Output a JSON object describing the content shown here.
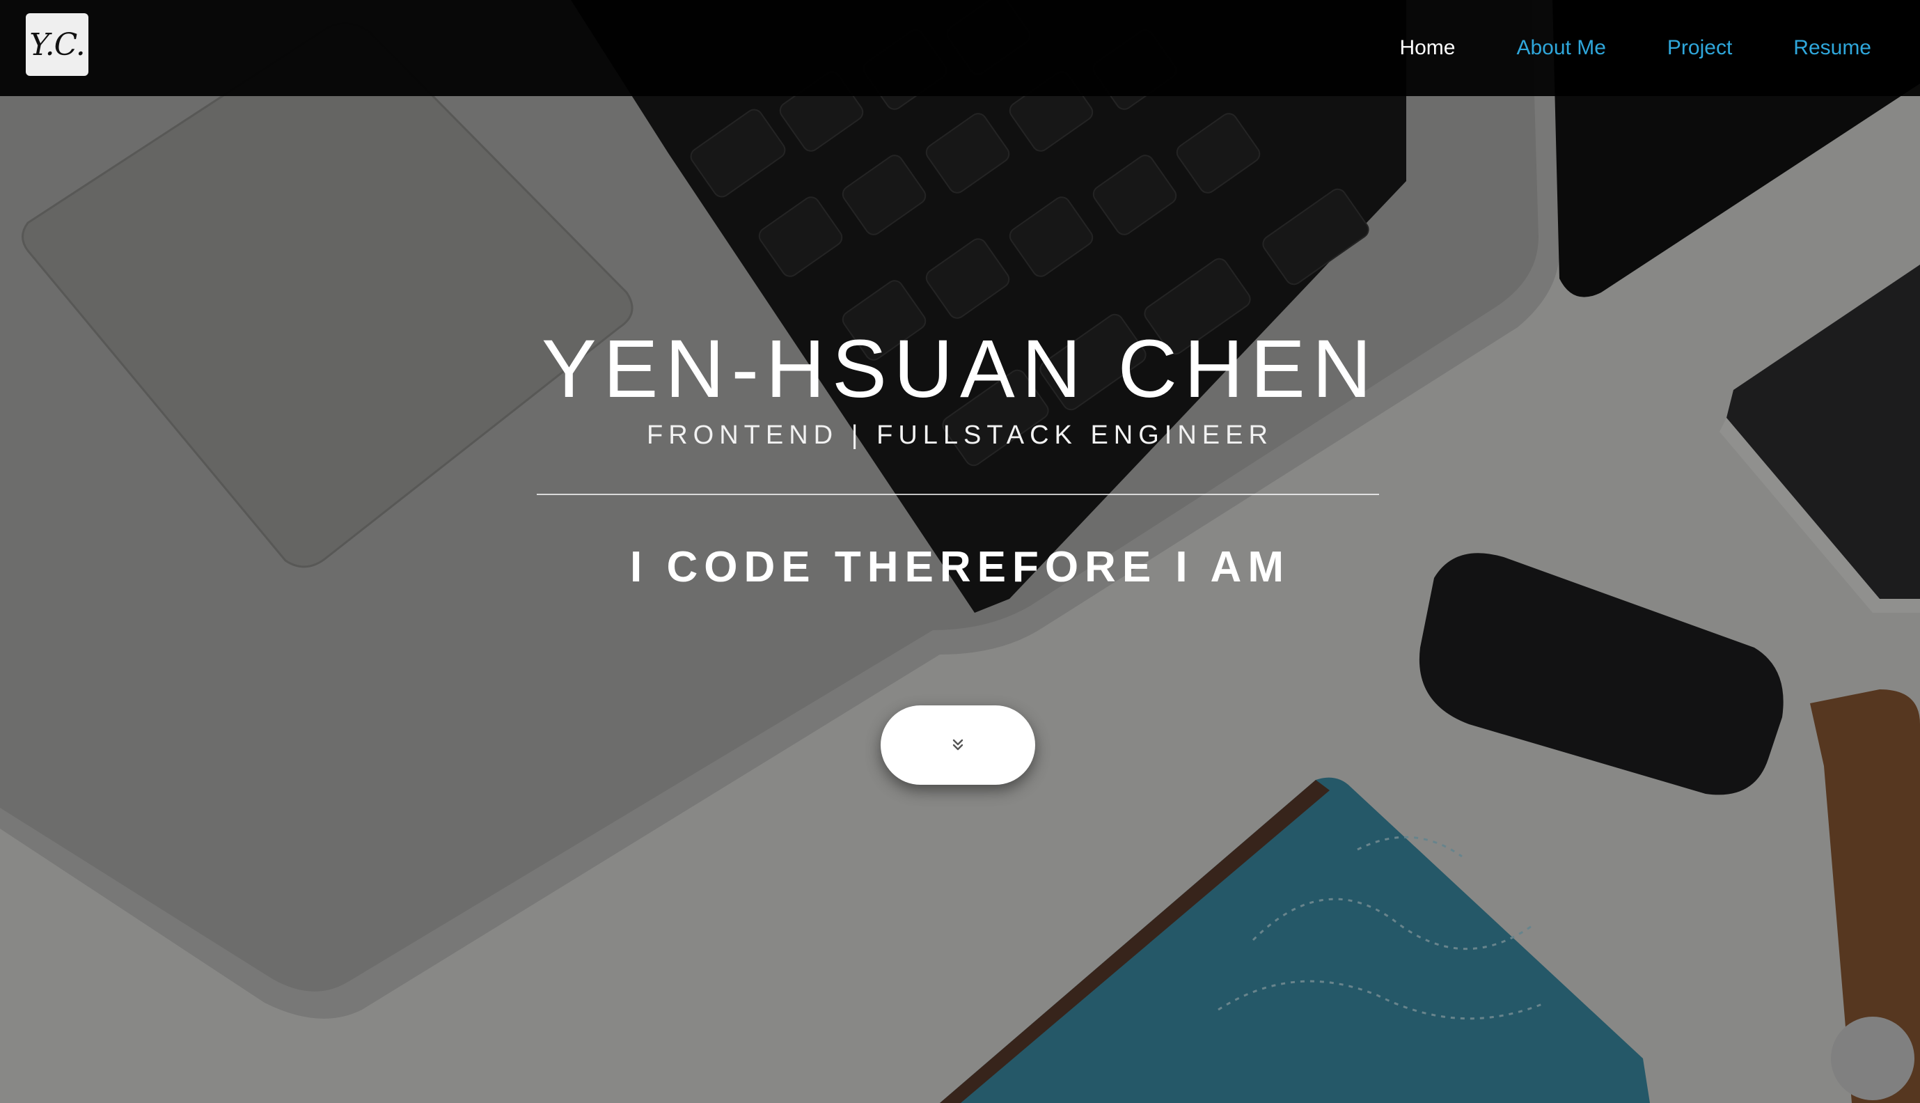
{
  "logo": {
    "text": "Y.C."
  },
  "nav": {
    "items": [
      {
        "label": "Home",
        "active": true
      },
      {
        "label": "About Me",
        "active": false
      },
      {
        "label": "Project",
        "active": false
      },
      {
        "label": "Resume",
        "active": false
      }
    ]
  },
  "hero": {
    "name": "YEN-HSUAN CHEN",
    "role": "FRONTEND | FULLSTACK ENGINEER",
    "tagline": "I CODE THEREFORE I AM",
    "scroll_icon": "double-chevron-down-icon"
  },
  "colors": {
    "nav_link": "#2fa7db",
    "nav_active": "#ffffff",
    "navbar_bg": "#000000"
  }
}
